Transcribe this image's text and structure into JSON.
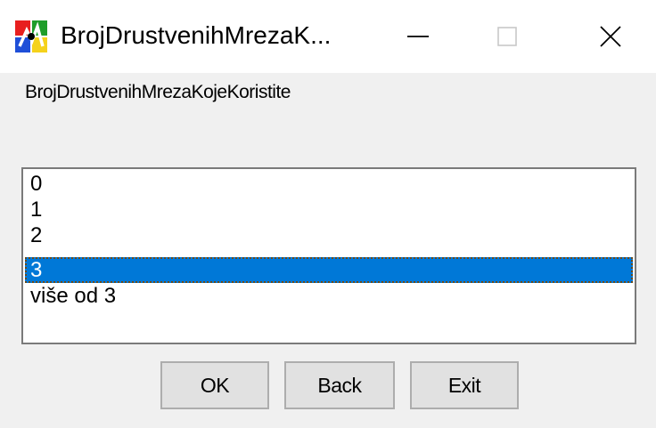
{
  "window": {
    "title": "BrojDrustvenihMrezaK...",
    "icon": "app-logo-icon",
    "controls": {
      "minimize": "minimize-icon",
      "maximize": "maximize-icon",
      "close": "close-icon"
    }
  },
  "prompt": {
    "label": "BrojDrustvenihMrezaKojeKoristite"
  },
  "listbox": {
    "items": [
      "0",
      "1",
      "2",
      "3",
      "više od 3"
    ],
    "selected_index": 3
  },
  "buttons": {
    "ok": "OK",
    "back": "Back",
    "exit": "Exit"
  },
  "colors": {
    "selection": "#0078d7",
    "window_bg": "#f0f0f0",
    "button_bg": "#e1e1e1"
  }
}
